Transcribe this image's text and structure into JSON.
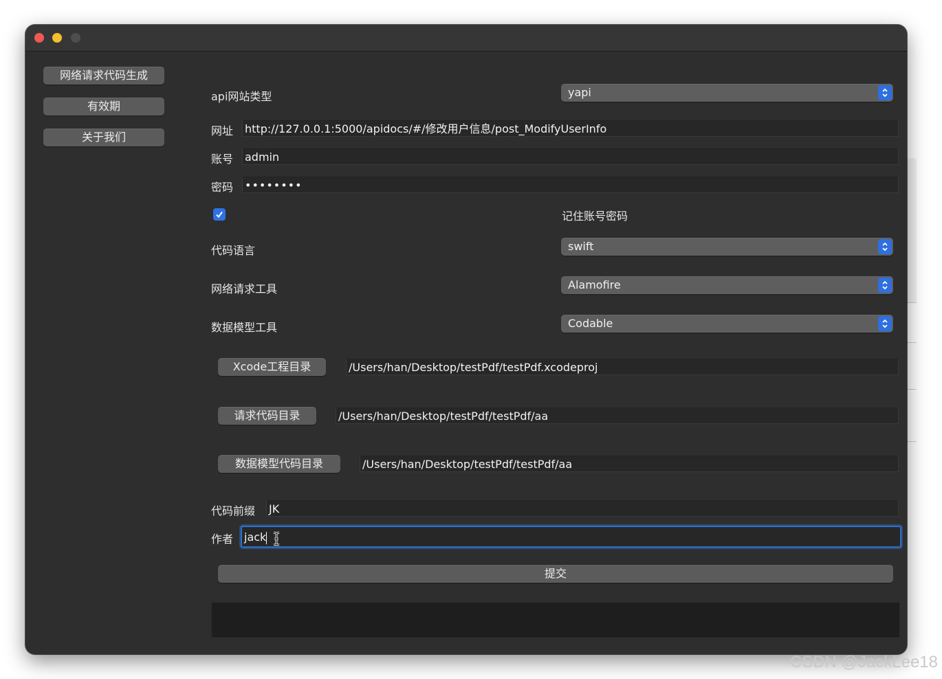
{
  "window": {
    "controls": [
      "close",
      "minimize",
      "zoom"
    ]
  },
  "sidebar": {
    "items": [
      {
        "label": "网络请求代码生成"
      },
      {
        "label": "有效期"
      },
      {
        "label": "关于我们"
      }
    ]
  },
  "form": {
    "api_type": {
      "label": "api网站类型",
      "value": "yapi"
    },
    "url": {
      "label": "网址",
      "value": "http://127.0.0.1:5000/apidocs/#/修改用户信息/post_ModifyUserInfo"
    },
    "account": {
      "label": "账号",
      "value": "admin"
    },
    "password": {
      "label": "密码",
      "value": "••••••••"
    },
    "remember": {
      "checked": true,
      "label": "记住账号密码"
    },
    "code_language": {
      "label": "代码语言",
      "value": "swift"
    },
    "network_tool": {
      "label": "网络请求工具",
      "value": "Alamofire"
    },
    "model_tool": {
      "label": "数据模型工具",
      "value": "Codable"
    },
    "xcode_dir": {
      "button": "Xcode工程目录",
      "value": "/Users/han/Desktop/testPdf/testPdf.xcodeproj"
    },
    "request_dir": {
      "button": "请求代码目录",
      "value": "/Users/han/Desktop/testPdf/testPdf/aa"
    },
    "model_dir": {
      "button": "数据模型代码目录",
      "value": "/Users/han/Desktop/testPdf/testPdf/aa"
    },
    "prefix": {
      "label": "代码前缀",
      "value": "JK"
    },
    "author": {
      "label": "作者",
      "value": "jack"
    },
    "submit": "提交"
  },
  "colors": {
    "accent": "#2f72e6",
    "window_bg": "#2e2e2e",
    "button_bg": "#5b5b5b",
    "focus_ring": "#2f6fc9"
  },
  "watermark": "CSDN @JackLee18"
}
